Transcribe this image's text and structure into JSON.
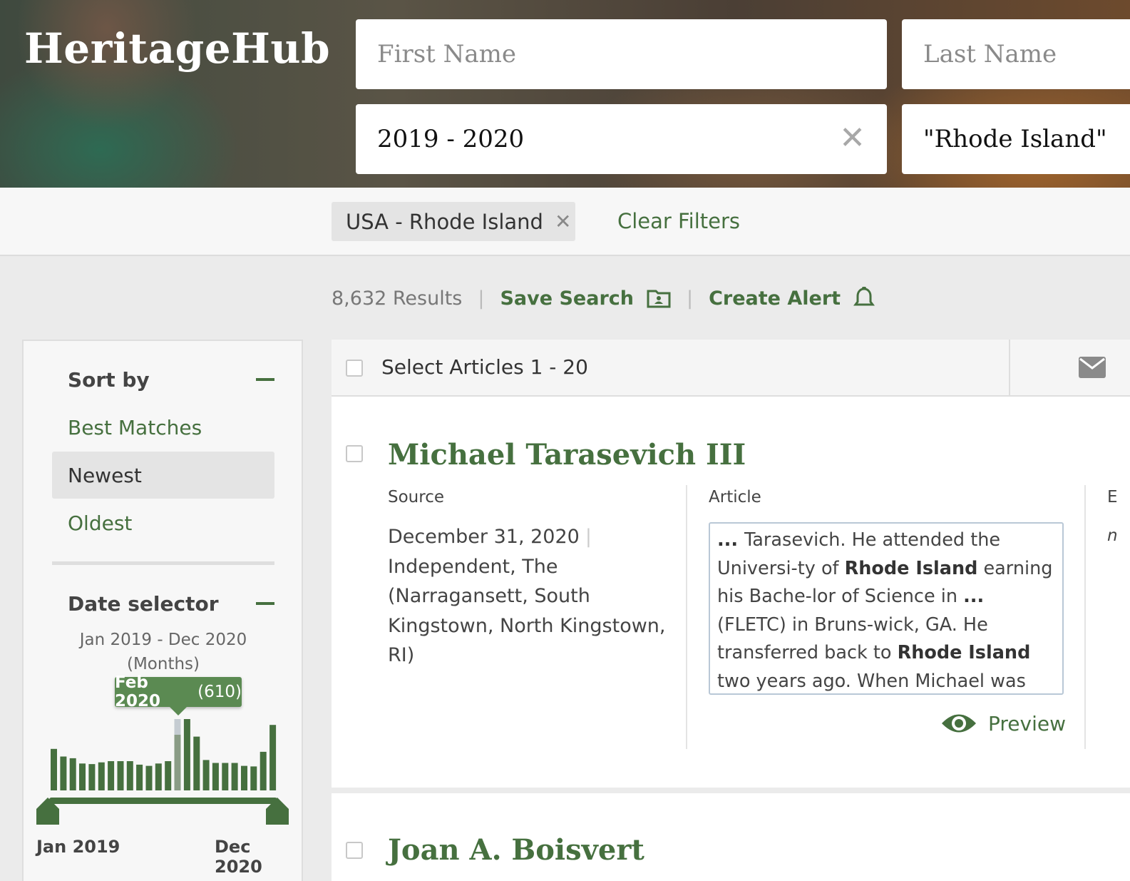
{
  "brand": {
    "logo": "HeritageHub"
  },
  "search": {
    "first_name_placeholder": "First Name",
    "last_name_placeholder": "Last Name",
    "date_value": "2019 - 2020",
    "date_clear": "✕",
    "place_value": "\"Rhode Island\""
  },
  "filters": {
    "chip_label": "USA - Rhode Island",
    "chip_remove": "✕",
    "clear_label": "Clear Filters"
  },
  "results_bar": {
    "count": "8,632 Results",
    "separator": "|",
    "save_search": "Save Search",
    "create_alert": "Create Alert"
  },
  "sidebar": {
    "sort_heading": "Sort by",
    "sort_options": [
      "Best Matches",
      "Newest",
      "Oldest"
    ],
    "sort_active": "Newest",
    "date_heading": "Date selector",
    "date_range": "Jan 2019 - Dec 2020",
    "date_unit": "(Months)",
    "tooltip_month": "Feb 2020",
    "tooltip_count": "(610)",
    "axis_start": "Jan 2019",
    "axis_end": "Dec 2020"
  },
  "chart_data": {
    "type": "bar",
    "categories": [
      "Jan 2019",
      "Feb 2019",
      "Mar 2019",
      "Apr 2019",
      "May 2019",
      "Jun 2019",
      "Jul 2019",
      "Aug 2019",
      "Sep 2019",
      "Oct 2019",
      "Nov 2019",
      "Dec 2019",
      "Jan 2020",
      "Feb 2020",
      "Mar 2020",
      "Apr 2020",
      "May 2020",
      "Jun 2020",
      "Jul 2020",
      "Aug 2020",
      "Sep 2020",
      "Oct 2020",
      "Nov 2020",
      "Dec 2020"
    ],
    "values": [
      355,
      290,
      275,
      230,
      225,
      240,
      250,
      250,
      250,
      220,
      210,
      230,
      250,
      610,
      610,
      460,
      260,
      235,
      235,
      235,
      210,
      205,
      330,
      560
    ],
    "highlight": "Feb 2020",
    "colors": {
      "bar": "#46703f",
      "highlight": "#8a9c86",
      "highlight_top": "#c5ccd2"
    }
  },
  "list": {
    "select_label": "Select Articles 1 - 20",
    "results": [
      {
        "title": "Michael Tarasevich III",
        "source_label": "Source",
        "date": "December 31, 2020",
        "publication": "Independent, The (Narragansett, South Kingstown, North Kingstown, RI)",
        "article_label": "Article",
        "snippet_parts": [
          {
            "t": "... ",
            "b": true
          },
          {
            "t": "Tarasevich. He attended the Universi-ty of ",
            "b": false
          },
          {
            "t": "Rhode Island",
            "b": true
          },
          {
            "t": " earning his Bache-lor of Science in ",
            "b": false
          },
          {
            "t": "...",
            "b": true
          },
          {
            "t": " (FLETC) in Bruns-wick, GA. He transferred back to ",
            "b": false
          },
          {
            "t": "Rhode Island",
            "b": true
          },
          {
            "t": " two years ago. When Michael was not working, he ",
            "b": false
          },
          {
            "t": "...",
            "b": true
          }
        ],
        "preview_label": "Preview",
        "event_label_cut": "E",
        "event_value_cut": "n"
      },
      {
        "title": "Joan A. Boisvert"
      }
    ]
  }
}
